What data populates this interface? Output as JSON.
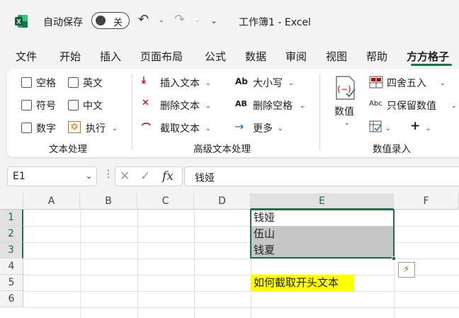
{
  "titlebar": {
    "autosave_label": "自动保存",
    "autosave_state": "关",
    "doc_title": "工作簿1  -  Excel"
  },
  "tabs": [
    "文件",
    "开始",
    "插入",
    "页面布局",
    "公式",
    "数据",
    "审阅",
    "视图",
    "帮助",
    "方方格子"
  ],
  "active_tab": "方方格子",
  "ribbon": {
    "text_group": {
      "label": "文本处理",
      "checks": [
        "空格",
        "英文",
        "符号",
        "中文",
        "数字"
      ],
      "execute": "执行"
    },
    "adv_group": {
      "label": "高级文本处理",
      "insert_text": "插入文本",
      "delete_text": "删除文本",
      "extract_text": "截取文本",
      "case": "大小写",
      "delete_space": "删除空格",
      "more": "更多"
    },
    "num_group": {
      "label": "数值录入",
      "values": "数值",
      "round": "四舍五入",
      "keep_values": "只保留数值",
      "icon_ab": "Ab",
      "icon_abc": "Abc",
      "icon_AB": "AB"
    }
  },
  "formula_bar": {
    "name_box": "E1",
    "fx": "fx",
    "content": "钱娅"
  },
  "grid": {
    "columns": [
      "A",
      "B",
      "C",
      "D",
      "E",
      "F"
    ],
    "rows": [
      "1",
      "2",
      "3",
      "4",
      "5",
      "6"
    ],
    "selected_column": "E",
    "cells": {
      "E1": "钱娅",
      "E2": "伍山",
      "E3": "钱夏",
      "E5": "如何截取开头文本"
    }
  },
  "colors": {
    "accent": "#1f7244",
    "highlight": "#ffff00",
    "selection": "#c6c6c6"
  }
}
